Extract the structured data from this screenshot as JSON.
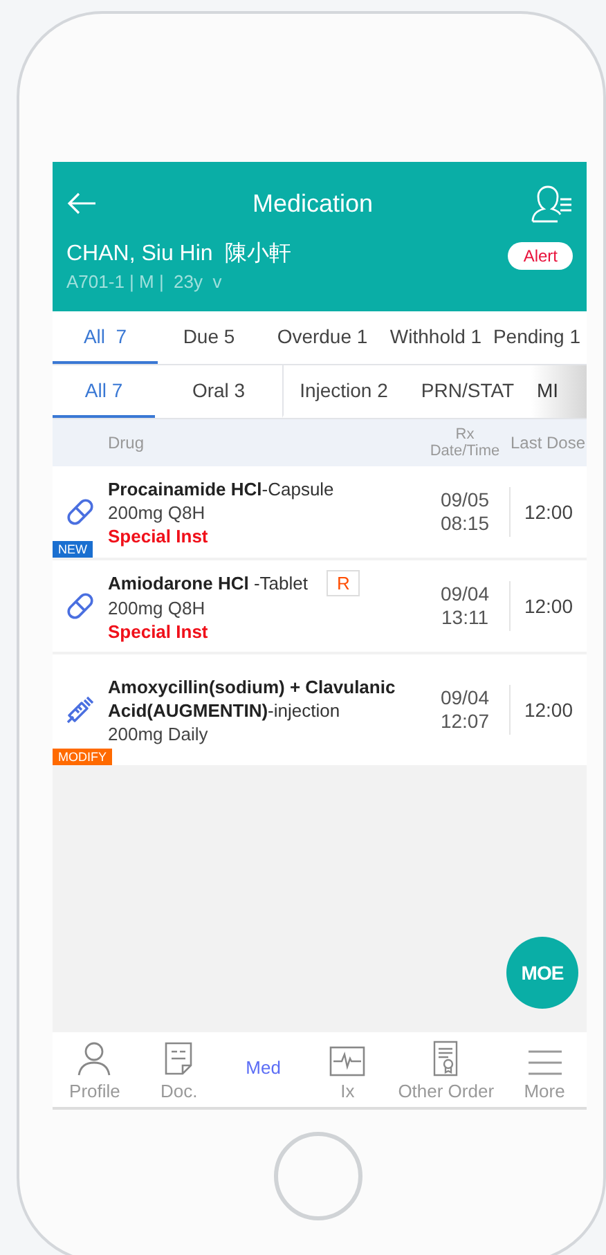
{
  "header": {
    "title": "Medication",
    "patient_name": "CHAN, Siu Hin  陳小軒",
    "patient_info": "A701-1 | M |  23y  v",
    "alert": "Alert"
  },
  "status_tabs": [
    {
      "label": "All  7",
      "selected": true
    },
    {
      "label": "Due 5",
      "selected": false
    },
    {
      "label": "Overdue 1",
      "selected": false
    },
    {
      "label": "Withhold 1",
      "selected": false
    },
    {
      "label": "Pending 1",
      "selected": false
    }
  ],
  "route_tabs": [
    {
      "label": "All 7",
      "selected": true
    },
    {
      "label": "Oral 3",
      "selected": false
    },
    {
      "label": "Injection 2",
      "selected": false
    },
    {
      "label": "PRN/STAT",
      "selected": false
    },
    {
      "label": "MI",
      "selected": false
    }
  ],
  "table": {
    "columns": [
      "Drug",
      "Rx Date/Time",
      "Last Dose"
    ],
    "rows": [
      {
        "kind": "capsule",
        "drug": "**Procainamide HCl**-Capsule",
        "dose": "200mg Q8H",
        "instruction": "Special Inst",
        "badge": {
          "kind": "new",
          "label": "NEW"
        },
        "rx_date": "09/05",
        "rx_time": "08:15",
        "last_dose": "12:00"
      },
      {
        "kind": "capsule",
        "drug": "**Amiodarone HCl** -Tablet",
        "flag": "R",
        "dose": "200mg Q8H",
        "instruction": "Special Inst",
        "rx_date": "09/04",
        "rx_time": "13:11",
        "last_dose": "12:00"
      },
      {
        "kind": "syringe",
        "drug": "**Amoxycillin(sodium) + Clavulanic Acid(AUGMENTIN)**-injection",
        "dose": "200mg Daily",
        "badge": {
          "kind": "modify",
          "label": "MODIFY"
        },
        "rx_date": "09/04",
        "rx_time": "12:07",
        "last_dose": "12:00"
      }
    ]
  },
  "fab": "MOE",
  "bottom_nav": [
    {
      "kind": "profile",
      "label": "Profile",
      "selected": false
    },
    {
      "kind": "document",
      "label": "Doc.",
      "selected": false
    },
    {
      "kind": "none",
      "label": "Med",
      "selected": true
    },
    {
      "kind": "chart",
      "label": "Ix",
      "selected": false
    },
    {
      "kind": "order",
      "label": "Other Order",
      "selected": false
    },
    {
      "kind": "menu",
      "label": "More",
      "selected": false
    }
  ]
}
